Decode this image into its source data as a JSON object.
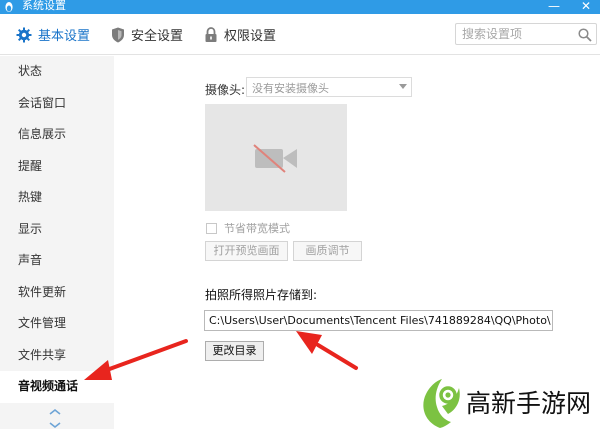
{
  "window": {
    "title": "系统设置",
    "min_glyph": "—",
    "close_glyph": "✕"
  },
  "tabs": [
    {
      "label": "基本设置",
      "icon": "gear-icon",
      "active": true
    },
    {
      "label": "安全设置",
      "icon": "shield-icon",
      "active": false
    },
    {
      "label": "权限设置",
      "icon": "lock-icon",
      "active": false
    }
  ],
  "search": {
    "placeholder": "搜索设置项",
    "value": ""
  },
  "sidebar": {
    "items": [
      {
        "label": "状态"
      },
      {
        "label": "会话窗口"
      },
      {
        "label": "信息展示"
      },
      {
        "label": "提醒"
      },
      {
        "label": "热键"
      },
      {
        "label": "显示"
      },
      {
        "label": "声音"
      },
      {
        "label": "软件更新"
      },
      {
        "label": "文件管理"
      },
      {
        "label": "文件共享"
      },
      {
        "label": "音视频通话"
      }
    ],
    "selected": "音视频通话"
  },
  "camera": {
    "label": "摄像头:",
    "select_value": "没有安装摄像头",
    "preview_icon": "camera-off-icon",
    "bandwidth_mode_label": "节省带宽模式",
    "bandwidth_mode_checked": false,
    "open_preview_label": "打开预览画面",
    "quality_label": "画质调节"
  },
  "photo": {
    "save_label": "拍照所得照片存储到:",
    "path": "C:\\Users\\User\\Documents\\Tencent Files\\741889284\\QQ\\Photo\\",
    "change_dir_label": "更改目录"
  },
  "annotations": {
    "arrow_color": "#e8251e"
  },
  "watermark": {
    "text": "高新手游网",
    "logo": "leaf-logo-icon"
  },
  "colors": {
    "titlebar": "#2f9be6",
    "active_tab": "#1a74c9",
    "sidebar_bg": "#f4f4f4"
  }
}
